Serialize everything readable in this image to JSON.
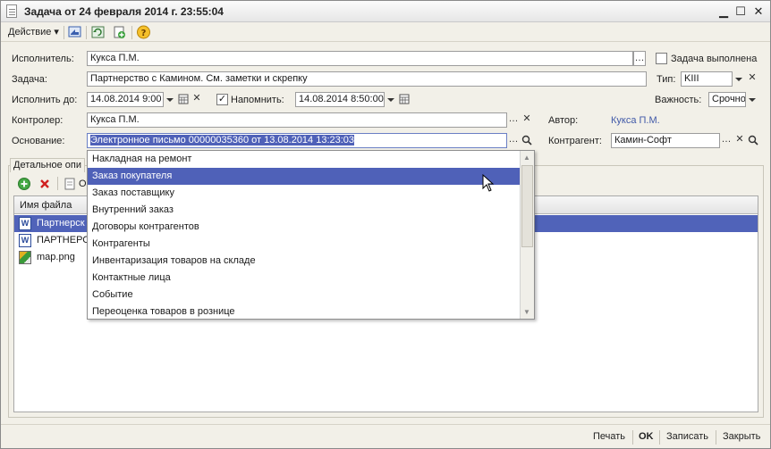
{
  "window": {
    "title": "Задача от 24 февраля 2014 г. 23:55:04",
    "minimize": "▁",
    "maximize": "☐",
    "close": "✕"
  },
  "toolbar": {
    "action_menu": "Действие ▾",
    "icons": [
      "goto-icon",
      "refresh-icon",
      "copy-icon",
      "help-icon"
    ]
  },
  "form": {
    "executor_label": "Исполнитель:",
    "executor_value": "Кукса П.М.",
    "done_label": "Задача выполнена",
    "task_label": "Задача:",
    "task_value": "Партнерство с Камином. См. заметки и скрепку",
    "type_label": "Тип:",
    "type_value": "KIII",
    "due_label": "Исполнить до:",
    "due_value": "14.08.2014  9:00",
    "remind_label": "Напомнить:",
    "remind_checked": "✓",
    "remind_value": "14.08.2014  8:50:00",
    "importance_label": "Важность:",
    "importance_value": "Срочно",
    "controller_label": "Контролер:",
    "controller_value": "Кукса П.М.",
    "author_label": "Автор:",
    "author_value": "Кукса П.М.",
    "basis_label": "Основание:",
    "basis_value": "Электронное письмо 00000035360 от 13.08.2014 13:23:03",
    "counterparty_label": "Контрагент:",
    "counterparty_value": "Камин-Софт"
  },
  "tab": {
    "label": "Детальное опи",
    "toolbar_partial": "О",
    "column_filename": "Имя файла",
    "files": [
      {
        "name": "Партнерск",
        "type": "word"
      },
      {
        "name": "ПАРТНЕРС",
        "type": "word"
      },
      {
        "name": "map.png",
        "type": "image"
      }
    ]
  },
  "dropdown": {
    "items": [
      "Накладная на ремонт",
      "Заказ покупателя",
      "Заказ поставщику",
      "Внутренний заказ",
      "Договоры контрагентов",
      "Контрагенты",
      "Инвентаризация товаров на складе",
      "Контактные лица",
      "Событие",
      "Переоценка товаров в рознице"
    ],
    "highlighted_index": 1
  },
  "bottom": {
    "print": "Печать",
    "ok": "OK",
    "save": "Записать",
    "close": "Закрыть"
  }
}
